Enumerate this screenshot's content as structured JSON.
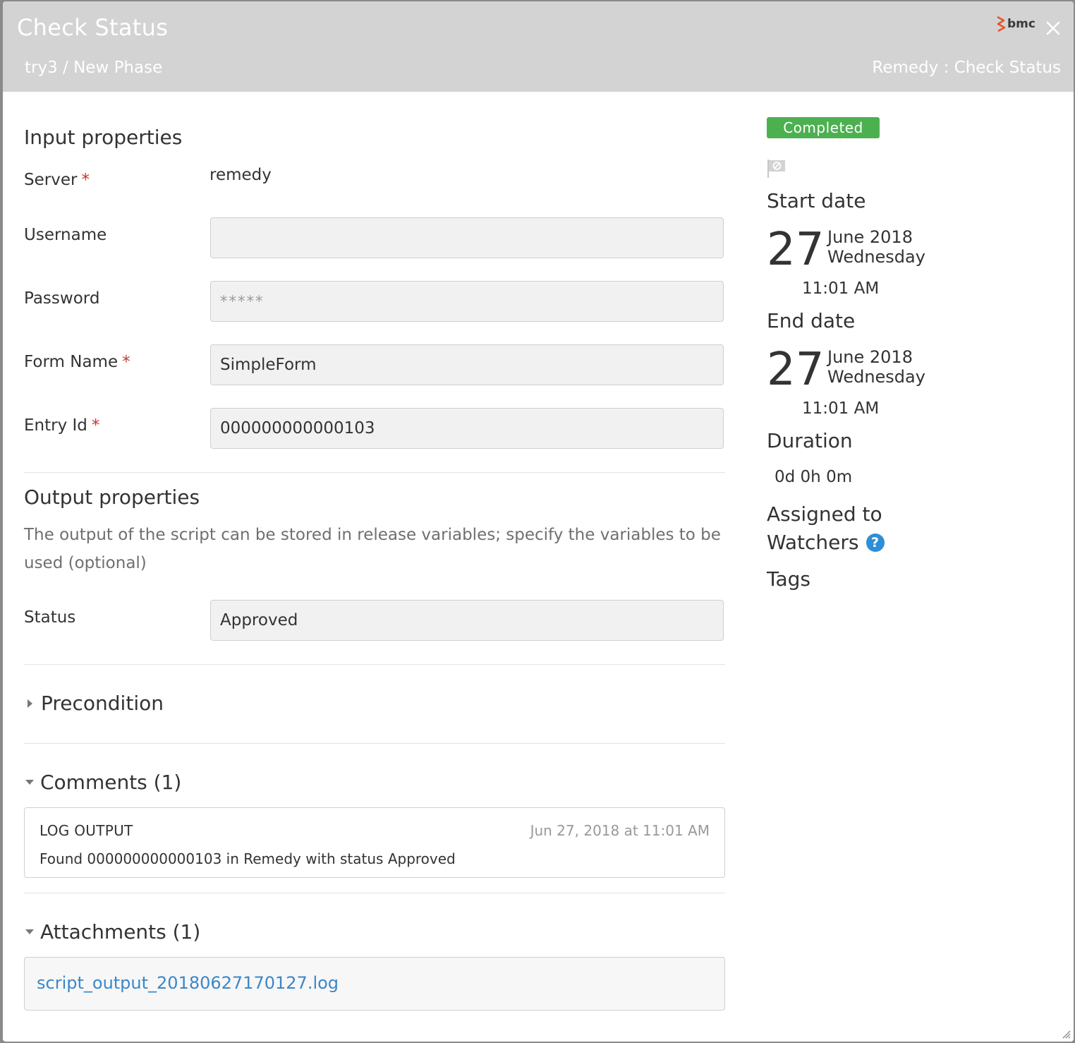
{
  "header": {
    "title": "Check Status",
    "breadcrumb": "try3 / New Phase",
    "task_type": "Remedy : Check Status",
    "logo_text": "bmc",
    "close_icon": "close-icon",
    "colors": {
      "header_bg": "#d3d3d3",
      "logo_accent": "#e8552b"
    }
  },
  "input_properties": {
    "title": "Input properties",
    "server": {
      "label": "Server",
      "required": "*",
      "value": "remedy"
    },
    "username": {
      "label": "Username",
      "value": ""
    },
    "password": {
      "label": "Password",
      "value": "*****"
    },
    "form_name": {
      "label": "Form Name",
      "required": "*",
      "value": "SimpleForm"
    },
    "entry_id": {
      "label": "Entry Id",
      "required": "*",
      "value": "000000000000103"
    }
  },
  "output_properties": {
    "title": "Output properties",
    "help_text": "The output of the script can be stored in release variables; specify the variables to be used (optional)",
    "status": {
      "label": "Status",
      "value": "Approved"
    }
  },
  "precondition": {
    "title": "Precondition"
  },
  "comments": {
    "title": "Comments (1)",
    "items": [
      {
        "author": "LOG OUTPUT",
        "date": "Jun 27, 2018 at 11:01 AM",
        "text": "Found 000000000000103 in Remedy with status Approved"
      }
    ]
  },
  "attachments": {
    "title": "Attachments (1)",
    "items": [
      {
        "name": "script_output_20180627170127.log"
      }
    ]
  },
  "sidebar": {
    "status": "Completed",
    "status_color": "#4cb050",
    "flag_icon": "flag-icon",
    "start_date": {
      "label": "Start date",
      "day": "27",
      "month_year": "June 2018",
      "weekday": "Wednesday",
      "time": "11:01 AM"
    },
    "end_date": {
      "label": "End date",
      "day": "27",
      "month_year": "June 2018",
      "weekday": "Wednesday",
      "time": "11:01 AM"
    },
    "duration": {
      "label": "Duration",
      "value": "0d 0h 0m"
    },
    "assigned_to": {
      "label": "Assigned to"
    },
    "watchers": {
      "label": "Watchers",
      "help": "?"
    },
    "tags": {
      "label": "Tags"
    }
  }
}
